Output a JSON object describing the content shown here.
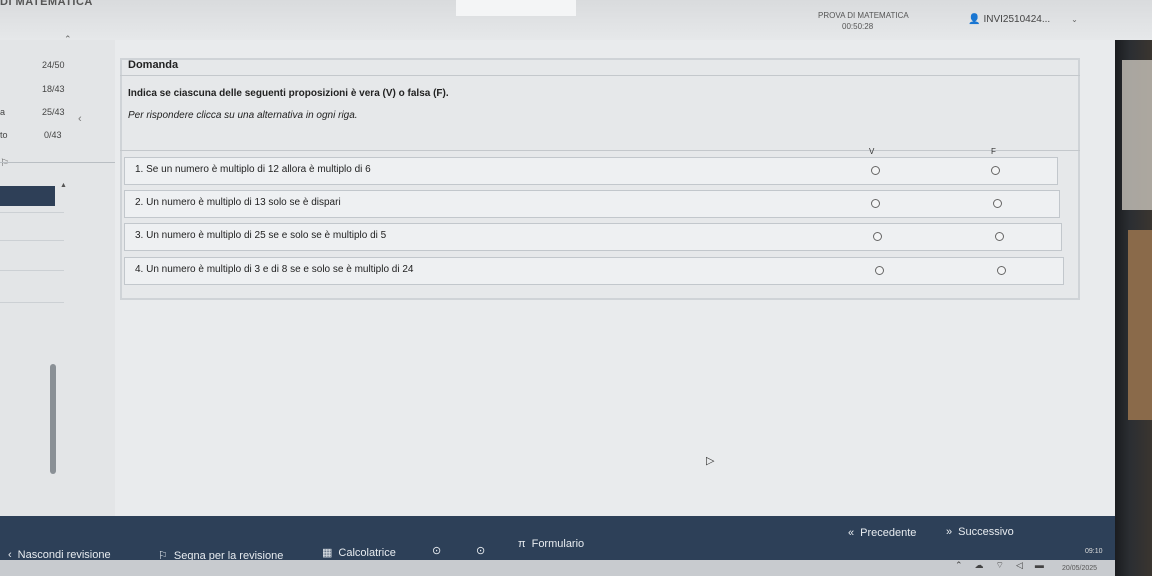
{
  "app": {
    "top_left_title": "DI MATEMATICA",
    "exam_title": "PROVA DI MATEMATICA",
    "timer": "00:50:28",
    "user_id": "INVI2510424..."
  },
  "sidebar": {
    "rows": [
      {
        "count": "24/50"
      },
      {
        "count": "18/43"
      },
      {
        "prefix": "a",
        "count": "25/43"
      },
      {
        "prefix": "to",
        "count": "0/43"
      }
    ]
  },
  "question": {
    "title": "Domanda",
    "instruction": "Indica se ciascuna delle seguenti proposizioni è vera (V) o falsa (F).",
    "hint": "Per rispondere clicca su una alternativa in ogni riga.",
    "col_true": "V",
    "col_false": "F",
    "statements": [
      {
        "text": "1. Se un numero è multiplo di 12  allora è multiplo di 6"
      },
      {
        "text": "2. Un numero è multiplo di 13  solo se è dispari"
      },
      {
        "text": "3. Un numero è multiplo di 25  se e solo se è multiplo di 5"
      },
      {
        "text": "4. Un numero è multiplo di 3  e di 8  se e solo se è multiplo di 24"
      }
    ]
  },
  "bottombar": {
    "hide_review": "Nascondi revisione",
    "mark_review": "Segna per la revisione",
    "calculator": "Calcolatrice",
    "formulary": "Formulario",
    "previous": "Precedente",
    "next": "Successivo"
  },
  "taskbar": {
    "time": "09:10",
    "date": "20/05/2025"
  },
  "colors": {
    "bottombar": "#2d4058",
    "active_question": "#2e3f57"
  }
}
